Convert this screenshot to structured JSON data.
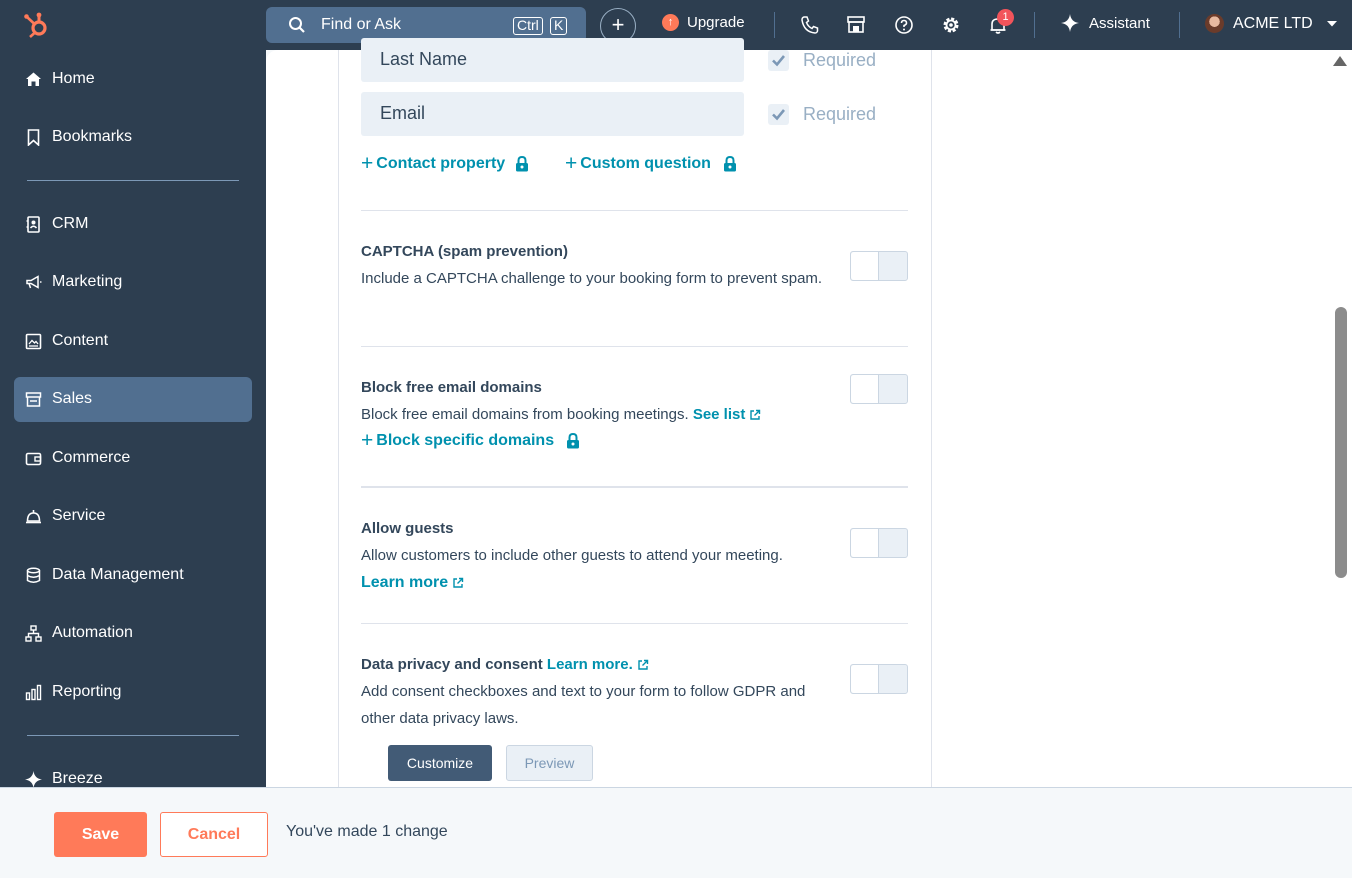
{
  "topbar": {
    "search_placeholder": "Find or Ask",
    "shortcut_ctrl": "Ctrl",
    "shortcut_key": "K",
    "upgrade_label": "Upgrade",
    "notification_count": "1",
    "assistant_label": "Assistant",
    "account_name": "ACME LTD"
  },
  "sidebar": {
    "items": [
      {
        "label": "Home",
        "icon": "home-icon"
      },
      {
        "label": "Bookmarks",
        "icon": "bookmark-icon"
      },
      {
        "label": "CRM",
        "icon": "contacts-icon"
      },
      {
        "label": "Marketing",
        "icon": "megaphone-icon"
      },
      {
        "label": "Content",
        "icon": "content-icon"
      },
      {
        "label": "Sales",
        "icon": "sales-icon",
        "active": true
      },
      {
        "label": "Commerce",
        "icon": "wallet-icon"
      },
      {
        "label": "Service",
        "icon": "bell-service-icon"
      },
      {
        "label": "Data Management",
        "icon": "database-icon"
      },
      {
        "label": "Automation",
        "icon": "workflow-icon"
      },
      {
        "label": "Reporting",
        "icon": "bar-chart-icon"
      },
      {
        "label": "Breeze",
        "icon": "sparkle-icon"
      }
    ]
  },
  "form": {
    "fields": [
      {
        "label": "Last Name",
        "required_label": "Required"
      },
      {
        "label": "Email",
        "required_label": "Required"
      }
    ],
    "add_contact_property": "Contact property",
    "add_custom_question": "Custom question"
  },
  "sections": {
    "captcha": {
      "title": "CAPTCHA (spam prevention)",
      "description": "Include a CAPTCHA challenge to your booking form to prevent spam."
    },
    "block_domains": {
      "title": "Block free email domains",
      "description": "Block free email domains from booking meetings.",
      "link": "See list",
      "add_link": "Block specific domains"
    },
    "guests": {
      "title": "Allow guests",
      "description": "Allow customers to include other guests to attend your meeting.",
      "link": "Learn more"
    },
    "privacy": {
      "title": "Data privacy and consent",
      "title_link": "Learn more.",
      "description": "Add consent checkboxes and text to your form to follow GDPR and other data privacy laws.",
      "customize_label": "Customize",
      "preview_label": "Preview"
    }
  },
  "footer": {
    "save_label": "Save",
    "cancel_label": "Cancel",
    "change_message": "You've made 1 change"
  },
  "colors": {
    "nav_bg": "#2d3e50",
    "accent_teal": "#0091ae",
    "accent_orange": "#ff7a59"
  }
}
